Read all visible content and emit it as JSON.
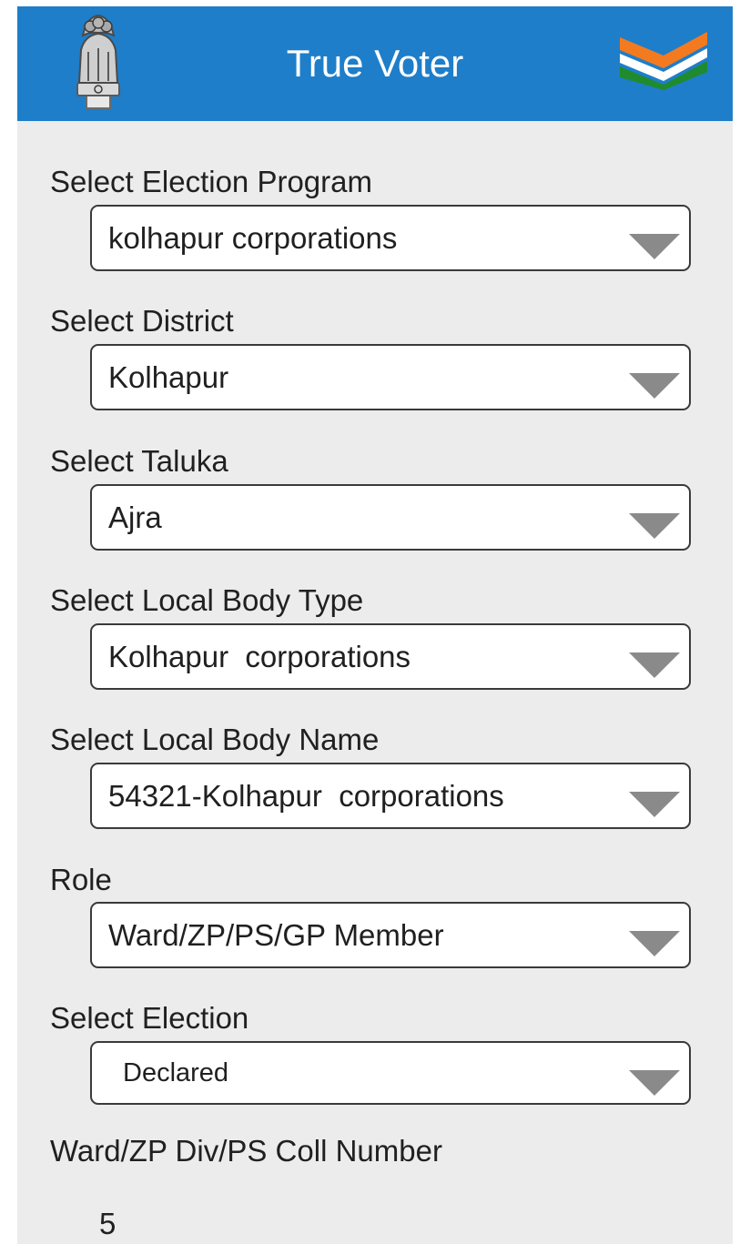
{
  "app_bar": {
    "title": "True Voter",
    "left_icon": "national-emblem-icon",
    "right_icon": "tricolor-chevron-icon",
    "background_color": "#1e7ec9"
  },
  "form": {
    "fields": [
      {
        "label": "Select Election Program",
        "value": "kolhapur corporations"
      },
      {
        "label": "Select District",
        "value": "Kolhapur"
      },
      {
        "label": "Select Taluka",
        "value": "Ajra"
      },
      {
        "label": "Select Local Body Type",
        "value": "Kolhapur  corporations"
      },
      {
        "label": "Select Local Body Name",
        "value": "54321-Kolhapur  corporations"
      },
      {
        "label": "Role",
        "value": "Ward/ZP/PS/GP Member"
      },
      {
        "label": "Select Election",
        "value": "Declared"
      }
    ],
    "number_field": {
      "label": "Ward/ZP Div/PS Coll Number",
      "value": "5"
    }
  }
}
